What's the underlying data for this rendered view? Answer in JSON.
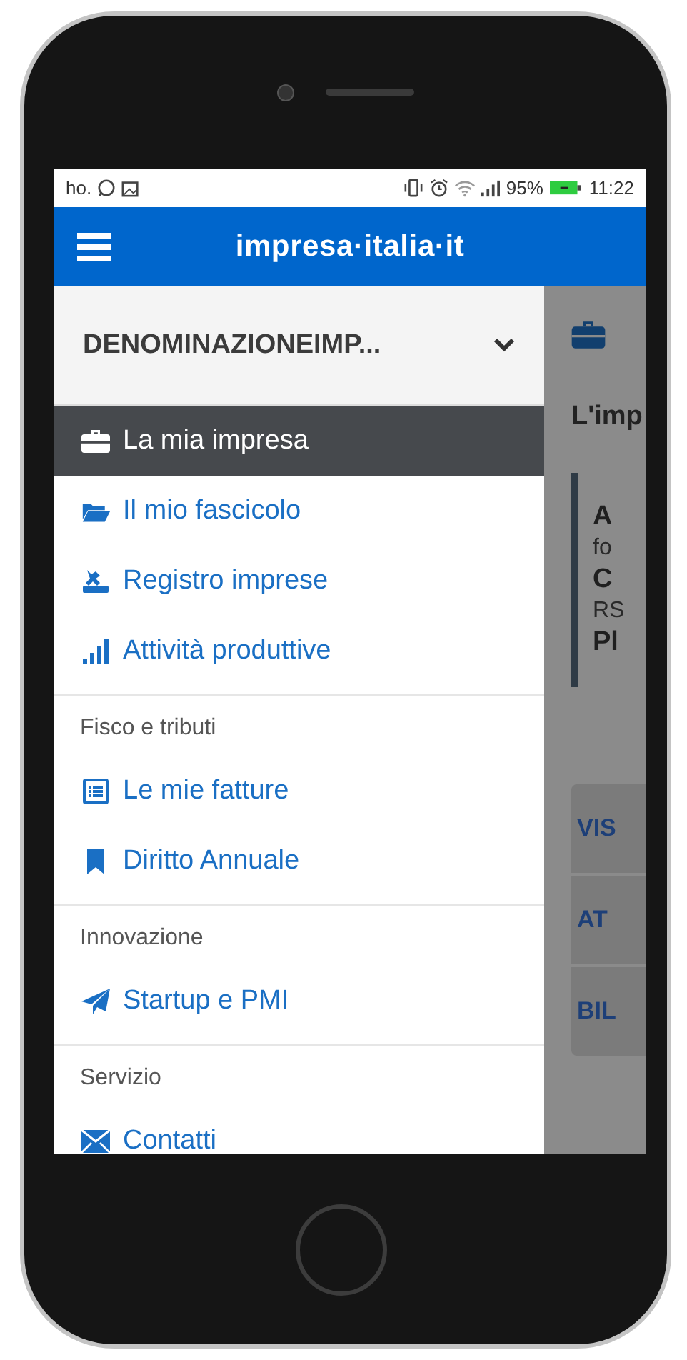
{
  "status_bar": {
    "carrier": "ho.",
    "battery_percent": "95%",
    "time": "11:22"
  },
  "app_bar": {
    "logo": "impresa·italia·it"
  },
  "drawer": {
    "company": "DENOMINAZIONEIMP...",
    "sections": [
      {
        "items": [
          {
            "label": "La mia impresa",
            "kind": "briefcase",
            "selected": true
          },
          {
            "label": "Il mio fascicolo",
            "kind": "folder",
            "selected": false
          },
          {
            "label": "Registro imprese",
            "kind": "stamp",
            "selected": false
          },
          {
            "label": "Attività produttive",
            "kind": "bars",
            "selected": false
          }
        ]
      },
      {
        "title": "Fisco e tributi",
        "items": [
          {
            "label": "Le mie fatture",
            "kind": "list",
            "selected": false
          },
          {
            "label": "Diritto Annuale",
            "kind": "bookmark",
            "selected": false
          }
        ]
      },
      {
        "title": "Innovazione",
        "items": [
          {
            "label": "Startup e PMI",
            "kind": "plane",
            "selected": false
          }
        ]
      },
      {
        "title": "Servizio",
        "items": [
          {
            "label": "Contatti",
            "kind": "envelope",
            "selected": false
          }
        ]
      }
    ]
  },
  "page": {
    "heading": "L'imp",
    "card_lines": [
      {
        "text": "A",
        "kind": "title"
      },
      {
        "text": "fo",
        "kind": "text"
      },
      {
        "text": "C",
        "kind": "title"
      },
      {
        "text": "RS",
        "kind": "text"
      },
      {
        "text": "Pl",
        "kind": "title"
      }
    ],
    "buttons": [
      "VIS",
      "AT",
      "BIL"
    ]
  }
}
